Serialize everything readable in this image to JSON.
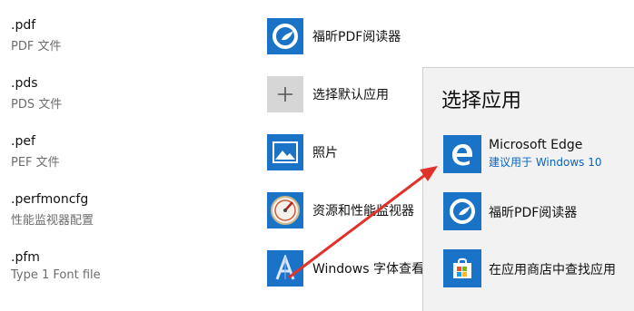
{
  "file_associations": [
    {
      "ext": ".pdf",
      "desc": "PDF 文件",
      "app": "福昕PDF阅读器",
      "icon": "foxit-icon"
    },
    {
      "ext": ".pds",
      "desc": "PDS 文件",
      "app": "选择默认应用",
      "icon": "plus-icon"
    },
    {
      "ext": ".pef",
      "desc": "PEF 文件",
      "app": "照片",
      "icon": "photos-icon"
    },
    {
      "ext": ".perfmoncfg",
      "desc": "性能监视器配置",
      "app": "资源和性能监视器",
      "icon": "perf-monitor-icon"
    },
    {
      "ext": ".pfm",
      "desc": "Type 1 Font file",
      "app": "Windows 字体查看",
      "icon": "font-viewer-icon"
    }
  ],
  "choose_app_panel": {
    "title": "选择应用",
    "items": [
      {
        "name": "Microsoft Edge",
        "sub": "建议用于 Windows 10",
        "icon": "edge-icon"
      },
      {
        "name": "福昕PDF阅读器",
        "icon": "foxit-icon"
      },
      {
        "name": "在应用商店中查找应用",
        "icon": "store-icon"
      }
    ]
  },
  "colors": {
    "accent": "#1a73c7",
    "arrow": "#e0322a",
    "panel": "#f2f2f2"
  }
}
